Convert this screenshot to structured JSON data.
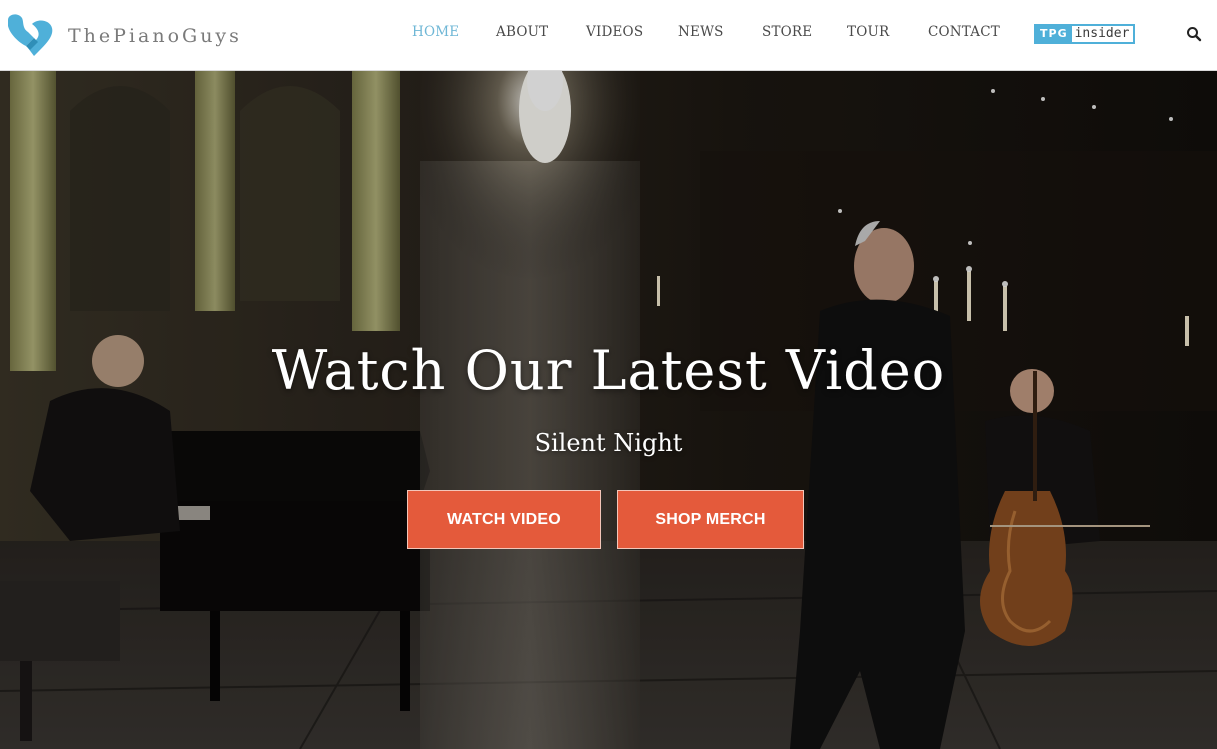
{
  "brand": {
    "name": "ThePianoGuys",
    "logo_icon": "heart-hands-logo-icon",
    "accent": "#6fb7d6"
  },
  "nav": {
    "items": [
      {
        "label": "HOME",
        "active": true
      },
      {
        "label": "ABOUT",
        "active": false
      },
      {
        "label": "VIDEOS",
        "active": false
      },
      {
        "label": "NEWS",
        "active": false
      },
      {
        "label": "STORE",
        "active": false
      },
      {
        "label": "TOUR",
        "active": false
      },
      {
        "label": "CONTACT",
        "active": false
      }
    ],
    "insider": {
      "badge": "TPG",
      "word": "insider"
    },
    "search_icon": "search-icon"
  },
  "hero": {
    "title": "Watch Our Latest Video",
    "subtitle": "Silent Night",
    "buttons": {
      "watch": "WATCH VIDEO",
      "shop": "SHOP MERCH"
    },
    "button_color": "#e45a3b"
  }
}
